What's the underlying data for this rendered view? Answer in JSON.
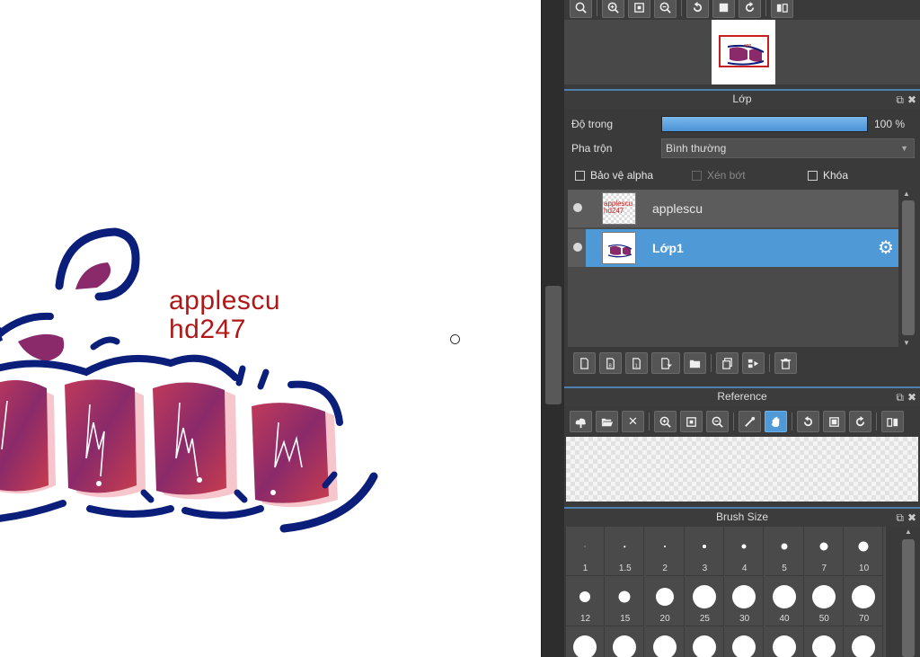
{
  "canvas": {
    "art_text_line1": "applescu",
    "art_text_line2": "hd247"
  },
  "navigator": {
    "toolbar_icons": [
      "zoom-fit-icon",
      "zoom-in-icon",
      "fit-screen-icon",
      "zoom-out-icon",
      "rotate-left-icon",
      "actual-size-icon",
      "rotate-right-icon",
      "flip-icon"
    ]
  },
  "layer_panel": {
    "title": "Lớp",
    "opacity_label": "Độ trong",
    "opacity_value": "100 %",
    "opacity_fraction": 1.0,
    "blend_label": "Pha trộn",
    "blend_value": "Bình thường",
    "protect_alpha": "Bảo vệ alpha",
    "clipping": "Xén bớt",
    "lock": "Khóa",
    "layers": [
      {
        "name": "applescu",
        "thumb_text": "applescu hd247",
        "selected": false
      },
      {
        "name": "Lớp1",
        "selected": true
      }
    ],
    "toolbar_icons": [
      "new-layer-icon",
      "new-layer-8bit-icon",
      "new-layer-1bit-icon",
      "add-halftone-icon",
      "new-folder-icon",
      "duplicate-layer-icon",
      "merge-down-icon",
      "delete-layer-icon"
    ]
  },
  "reference_panel": {
    "title": "Reference",
    "toolbar_icons": [
      "cloud-icon",
      "open-folder-icon",
      "close-icon",
      "zoom-in-icon",
      "fit-screen-icon",
      "zoom-out-icon",
      "eyedropper-icon",
      "hand-icon",
      "rotate-left-icon",
      "actual-size-icon",
      "rotate-right-icon",
      "flip-icon"
    ]
  },
  "brush_size_panel": {
    "title": "Brush Size",
    "sizes": [
      "1",
      "1.5",
      "2",
      "3",
      "4",
      "5",
      "7",
      "10",
      "12",
      "15",
      "20",
      "25",
      "30",
      "40",
      "50",
      "70",
      "",
      "",
      "",
      "",
      "",
      "",
      "",
      ""
    ]
  },
  "colors": {
    "accent": "#4f9ad6",
    "panel_bg": "#3a3a3a",
    "art_text": "#b01818",
    "art_navy": "#0b1f7a",
    "art_purple": "#8a2a6a"
  }
}
